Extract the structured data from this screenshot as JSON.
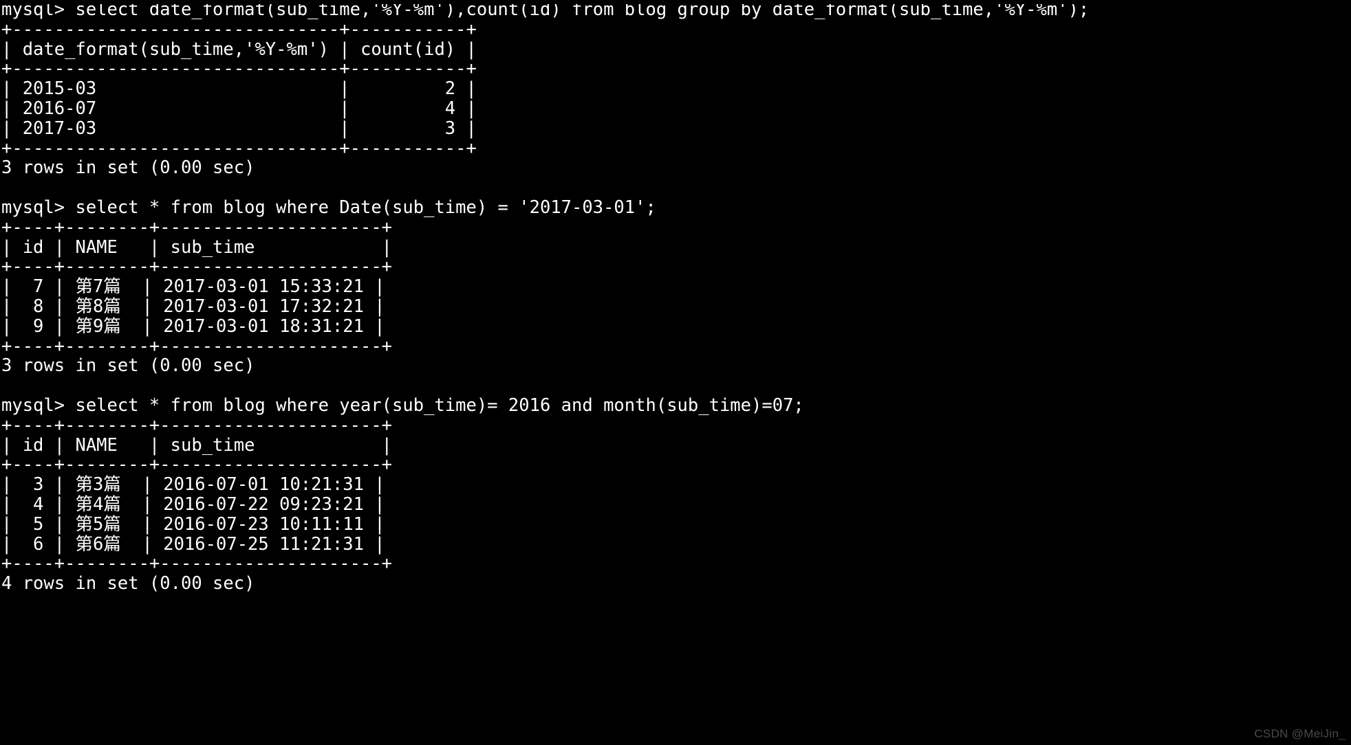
{
  "terminal": {
    "prompt": "mysql> ",
    "background_color": "#000000",
    "foreground_color": "#ffffff",
    "lines": [
      "mysql> select date_format(sub_time,'%Y-%m'),count(id) from blog group by date_format(sub_time,'%Y-%m');",
      "+-------------------------------+-----------+",
      "| date_format(sub_time,'%Y-%m') | count(id) |",
      "+-------------------------------+-----------+",
      "| 2015-03                       |         2 |",
      "| 2016-07                       |         4 |",
      "| 2017-03                       |         3 |",
      "+-------------------------------+-----------+",
      "3 rows in set (0.00 sec)",
      "",
      "mysql> select * from blog where Date(sub_time) = '2017-03-01';",
      "+----+--------+---------------------+",
      "| id | NAME   | sub_time            |",
      "+----+--------+---------------------+",
      "|  7 | 第7篇  | 2017-03-01 15:33:21 |",
      "|  8 | 第8篇  | 2017-03-01 17:32:21 |",
      "|  9 | 第9篇  | 2017-03-01 18:31:21 |",
      "+----+--------+---------------------+",
      "3 rows in set (0.00 sec)",
      "",
      "mysql> select * from blog where year(sub_time)= 2016 and month(sub_time)=07;",
      "+----+--------+---------------------+",
      "| id | NAME   | sub_time            |",
      "+----+--------+---------------------+",
      "|  3 | 第3篇  | 2016-07-01 10:21:31 |",
      "|  4 | 第4篇  | 2016-07-22 09:23:21 |",
      "|  5 | 第5篇  | 2016-07-23 10:11:11 |",
      "|  6 | 第6篇  | 2016-07-25 11:21:31 |",
      "+----+--------+---------------------+",
      "4 rows in set (0.00 sec)"
    ],
    "queries": [
      {
        "sql": "select date_format(sub_time,'%Y-%m'),count(id) from blog group by date_format(sub_time,'%Y-%m');",
        "columns": [
          "date_format(sub_time,'%Y-%m')",
          "count(id)"
        ],
        "rows": [
          [
            "2015-03",
            "2"
          ],
          [
            "2016-07",
            "4"
          ],
          [
            "2017-03",
            "3"
          ]
        ],
        "status": "3 rows in set (0.00 sec)"
      },
      {
        "sql": "select * from blog where Date(sub_time) = '2017-03-01';",
        "columns": [
          "id",
          "NAME",
          "sub_time"
        ],
        "rows": [
          [
            "7",
            "第7篇",
            "2017-03-01 15:33:21"
          ],
          [
            "8",
            "第8篇",
            "2017-03-01 17:32:21"
          ],
          [
            "9",
            "第9篇",
            "2017-03-01 18:31:21"
          ]
        ],
        "status": "3 rows in set (0.00 sec)"
      },
      {
        "sql": "select * from blog where year(sub_time)= 2016 and month(sub_time)=07;",
        "columns": [
          "id",
          "NAME",
          "sub_time"
        ],
        "rows": [
          [
            "3",
            "第3篇",
            "2016-07-01 10:21:31"
          ],
          [
            "4",
            "第4篇",
            "2016-07-22 09:23:21"
          ],
          [
            "5",
            "第5篇",
            "2016-07-23 10:11:11"
          ],
          [
            "6",
            "第6篇",
            "2016-07-25 11:21:31"
          ]
        ],
        "status": "4 rows in set (0.00 sec)"
      }
    ]
  },
  "watermark": {
    "text": "CSDN @MeiJin_",
    "color": "#4a4a4a"
  }
}
